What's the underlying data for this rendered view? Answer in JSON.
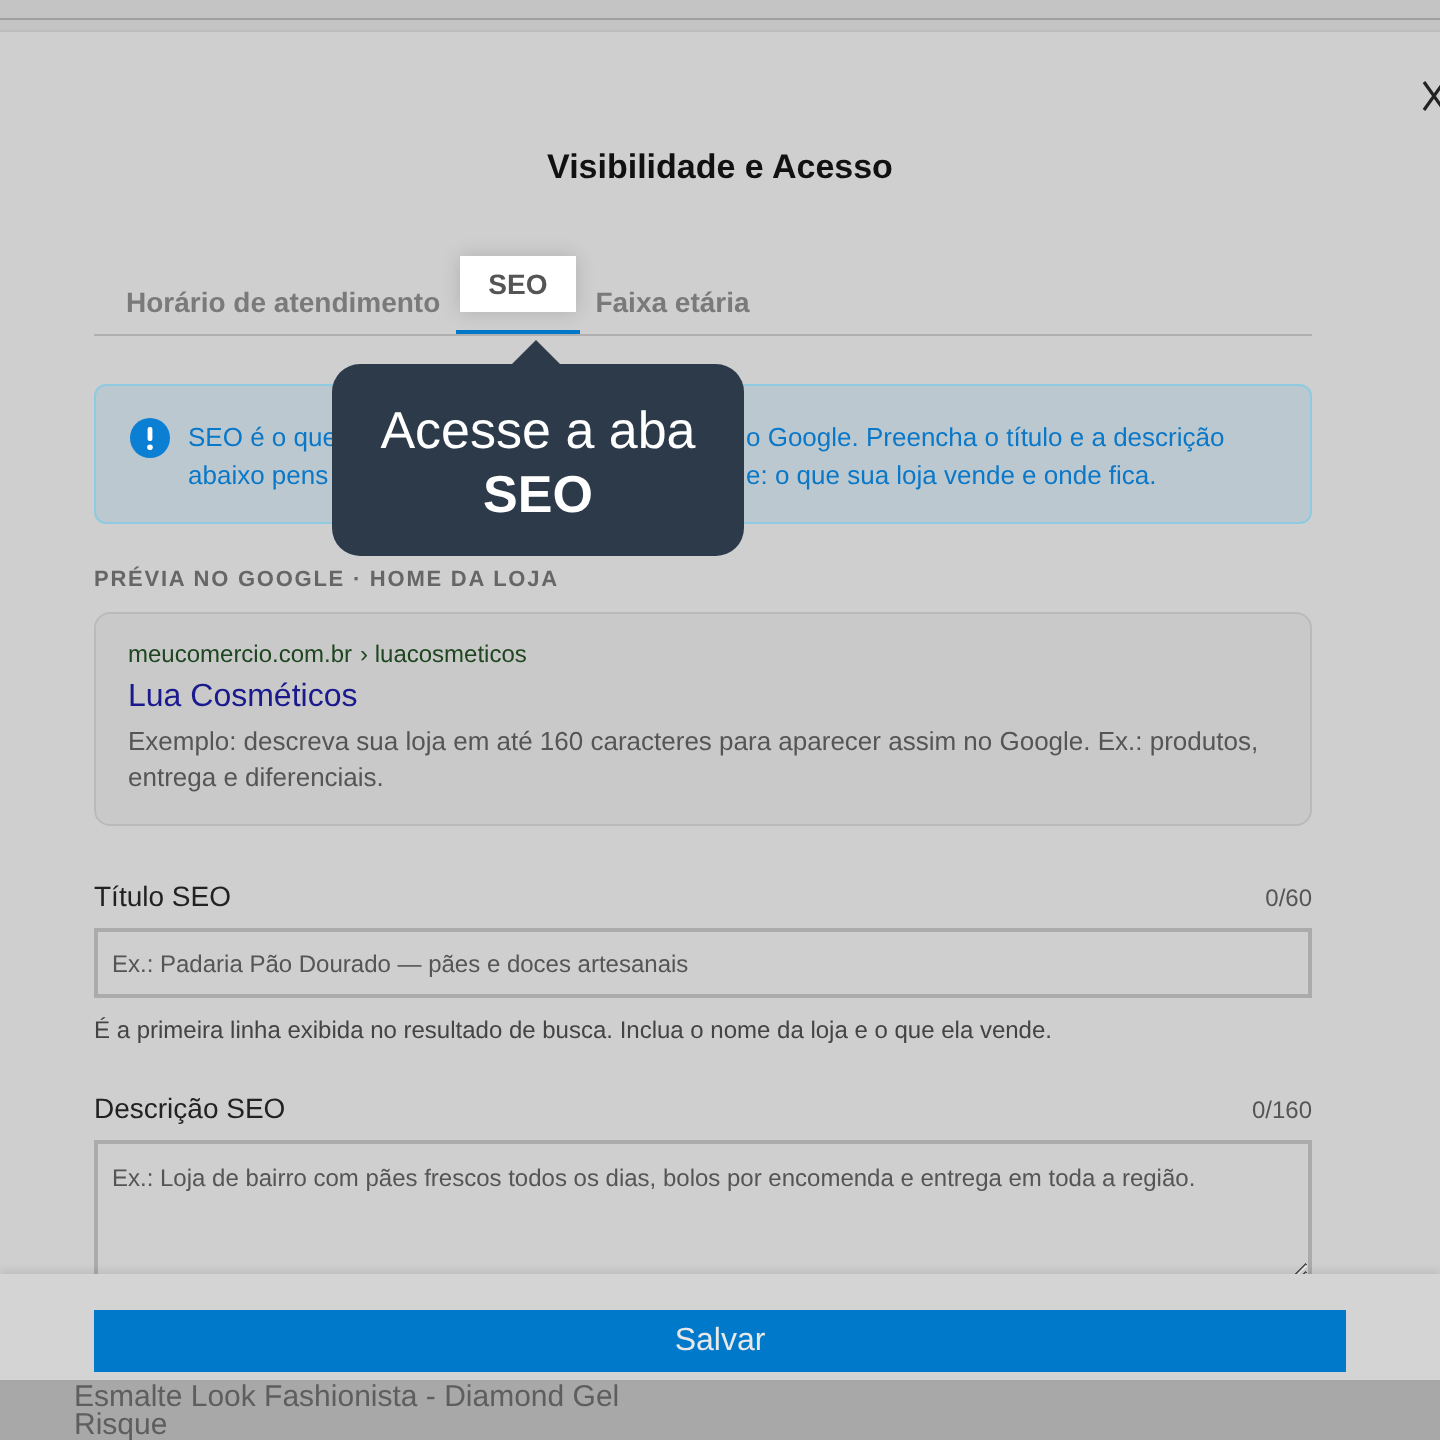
{
  "dialog": {
    "title": "Visibilidade e Acesso"
  },
  "tabs": [
    {
      "label": "Horário de atendimento",
      "selected": false
    },
    {
      "label": "SEO",
      "selected": true
    },
    {
      "label": "Faixa etária",
      "selected": false
    }
  ],
  "tooltip": {
    "text": "Acesse a aba **SEO**"
  },
  "alert": {
    "lines": [
      {
        "left": "SEO é o que",
        "right": "o Google. Preencha o título e a descrição"
      },
      {
        "left": "abaixo pens",
        "right": "e: o que sua loja vende e onde fica."
      }
    ]
  },
  "preview": {
    "heading": "PRÉVIA NO GOOGLE · HOME DA LOJA",
    "site": "meucomercio.com.br",
    "path": "› luacosmeticos",
    "title": "Lua Cosméticos",
    "description": "Exemplo: descreva sua loja em até 160 caracteres para aparecer assim no Google. Ex.: produtos, entrega e diferenciais."
  },
  "fields": [
    {
      "kind": "input",
      "label": "Título SEO",
      "count": "0/60",
      "placeholder": "Ex.: Padaria Pão Dourado — pães e doces artesanais",
      "hint": "É a primeira linha exibida no resultado de busca. Inclua o nome da loja e o que ela vende."
    },
    {
      "kind": "textarea",
      "label": "Descrição SEO",
      "count": "0/160",
      "placeholder": "Ex.: Loja de bairro com pães frescos todos os dias, bolos por encomenda e entrega em toda a região."
    }
  ],
  "footer": {
    "button": "Salvar"
  },
  "background_text": [
    "Esmalte Look Fashionista - Diamond Gel",
    "Risque"
  ]
}
